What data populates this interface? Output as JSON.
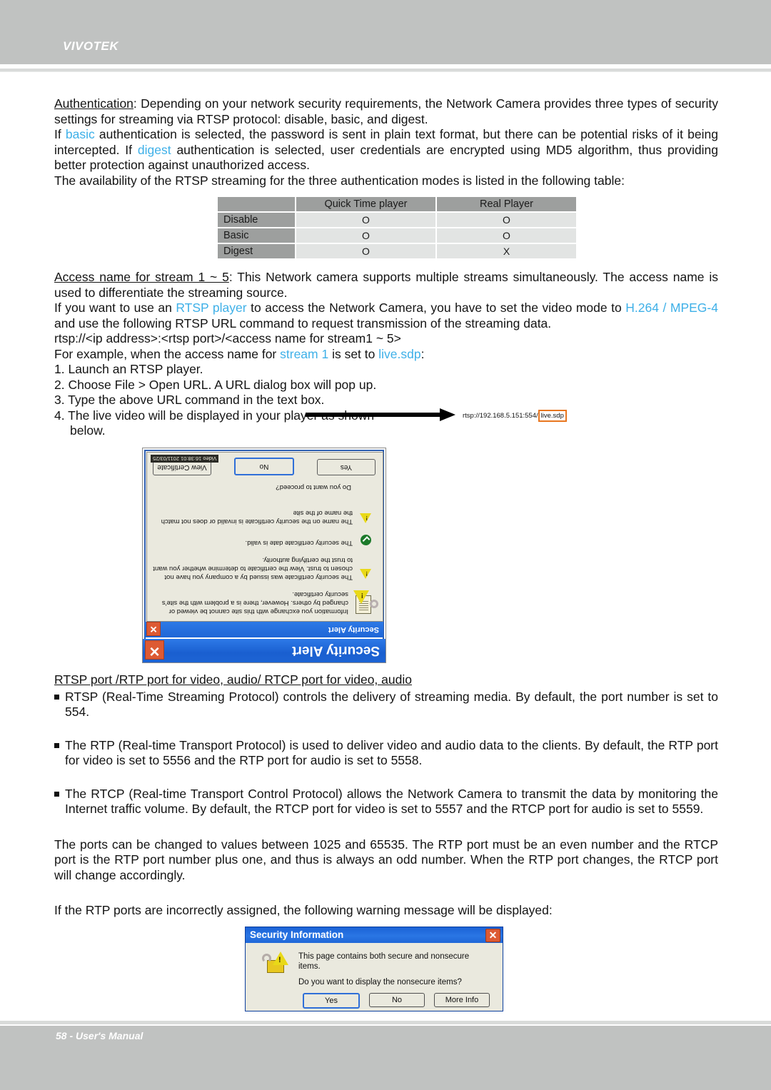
{
  "header": {
    "brand": "VIVOTEK"
  },
  "footer": {
    "text": "58 - User's Manual"
  },
  "body": {
    "auth_para": "Authentication",
    "auth_rest": ": Depending on your network security requirements, the Network Camera provides three types of security settings for streaming via RTSP protocol: disable, basic, and digest.",
    "basic_p1": "If ",
    "basic_word": "basic",
    "basic_p2": "  authentication is selected, the password is sent in plain text format, but there can be potential risks of it being intercepted. If ",
    "digest_word": "digest",
    "basic_p3": "  authentication is selected, user credentials are encrypted using MD5 algorithm, thus providing better protection against unauthorized access.",
    "avail_intro": "The availability of the RTSP streaming for the three authentication modes is listed in the following table:",
    "access_title": "Access name for stream 1 ~ 5",
    "access_rest": ": This Network camera supports multiple streams simultaneously. The access name is used to differentiate the streaming source.",
    "rtsp_p1": "If you want to use an ",
    "rtsp_player": "RTSP player",
    "rtsp_p2": " to access the Network Camera, you have to set the video mode to ",
    "codec": "H.264 / MPEG-4",
    "rtsp_p3": " and use the following RTSP URL command to request transmission of the streaming data.",
    "url_pattern": "rtsp://<ip address>:<rtsp port>/<access name for stream1 ~ 5>",
    "example_p1": "For example, when the access name for ",
    "example_stream": "stream 1",
    "example_p2": " is set to ",
    "example_sdp": "live.sdp",
    "example_p3": ":",
    "steps": [
      "1. Launch an RTSP player.",
      "2. Choose File > Open URL. A URL dialog box will pop up.",
      "3. Type the above URL command in the text box.",
      "4. The live video will be displayed in your player as shown",
      "below."
    ],
    "port_heading": "RTSP port /RTP port for video, audio/ RTCP port for video, audio",
    "bullets": [
      "RTSP (Real-Time Streaming Protocol) controls the delivery of streaming media. By default, the port number is set to 554.",
      "The RTP (Real-time Transport Protocol) is used to deliver video and audio data to the clients. By default, the RTP port for video is set to 5556 and the RTP port for audio is set to 5558.",
      "The RTCP (Real-time Transport Control Protocol) allows the Network Camera to transmit the data by monitoring the Internet traffic volume. By default, the RTCP port for video is set to 5557 and the RTCP port for audio is set to 5559."
    ],
    "ports_range_para": "The ports can be changed to values between 1025 and 65535. The RTP port must be an even number and the RTCP port is the RTP port number plus one, and thus is always an odd number. When the RTP port changes, the RTCP port will change accordingly.",
    "warning_intro": "If the RTP ports are incorrectly assigned, the following warning message will be displayed:"
  },
  "availability_table": {
    "columns": [
      "",
      "Quick Time player",
      "Real Player"
    ],
    "rows": [
      {
        "mode": "Disable",
        "values": [
          "O",
          "O"
        ]
      },
      {
        "mode": "Basic",
        "values": [
          "O",
          "O"
        ]
      },
      {
        "mode": "Digest",
        "values": [
          "O",
          "X"
        ]
      }
    ]
  },
  "url_callout": {
    "prefix": "rtsp://192.168.5.151:554/",
    "highlight": "live.sdp",
    "highlight_color": "#e8761f"
  },
  "security_alert_dialog": {
    "title": "Security Alert",
    "title_small": "Security Alert",
    "close_label": "✕",
    "heading": "Information you exchange with this site cannot be viewed or changed by others. However, there is a problem with the site's security certificate.",
    "items": [
      {
        "icon": "warning-triangle-icon",
        "text": "The security certificate was issued by a company you have not chosen to trust. View the certificate to determine whether you want to trust the certifying authority."
      },
      {
        "icon": "green-check-icon",
        "text": "The security certificate date is valid."
      },
      {
        "icon": "warning-triangle-icon",
        "text": "The name on the security certificate is invalid or does not match the name of the site"
      }
    ],
    "question": "Do you want to proceed?",
    "buttons": [
      "Yes",
      "No",
      "View Certificate"
    ],
    "video_stamp": "Video 16:38:01 2011/03/25"
  },
  "security_information_dialog": {
    "title": "Security Information",
    "close_label": "✕",
    "text1": "This page contains both secure and nonsecure items.",
    "text2": "Do you want to display the nonsecure items?",
    "buttons": [
      "Yes",
      "No",
      "More Info"
    ]
  },
  "colors": {
    "header_gray": "#c0c2c1",
    "accent_cyan": "#3eb0e8",
    "table_header_gray": "#9d9f9e",
    "table_cell_gray": "#e2e4e3",
    "dialog_blue": "#1f67d8",
    "callout_orange": "#e8761f"
  }
}
